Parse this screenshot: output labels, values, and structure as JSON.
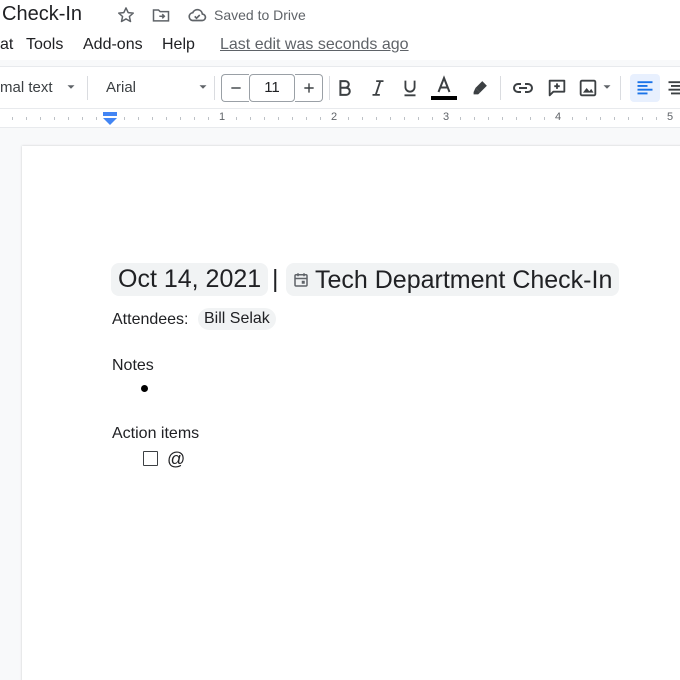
{
  "title_bar": {
    "doc_title": "Check-In",
    "save_status": "Saved to Drive"
  },
  "menu": {
    "items": [
      "at",
      "Tools",
      "Add-ons",
      "Help"
    ],
    "last_edit": "Last edit was seconds ago"
  },
  "toolbar": {
    "style_value": "mal text",
    "font_value": "Arial",
    "font_size": "11",
    "text_color": "#000000"
  },
  "ruler": {
    "numbers": [
      "1",
      "2",
      "3",
      "4",
      "5"
    ]
  },
  "document": {
    "date_chip": "Oct 14, 2021",
    "separator": "|",
    "event_chip": "Tech Department Check-In",
    "attendees_label": "Attendees:",
    "attendee": "Bill Selak",
    "notes_heading": "Notes",
    "action_heading": "Action items",
    "mention": "@"
  },
  "colors": {
    "accent": "#1a73e8",
    "chip_bg": "#f1f3f4"
  }
}
